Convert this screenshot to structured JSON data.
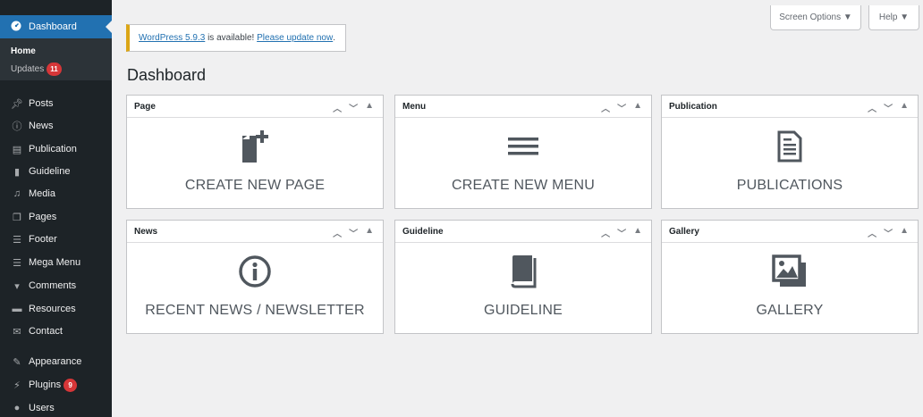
{
  "sidebar": {
    "dashboard_label": "Dashboard",
    "submenu": {
      "home": "Home",
      "updates": "Updates",
      "updates_badge": "11"
    },
    "items": [
      {
        "label": "Posts",
        "icon": "pin-icon"
      },
      {
        "label": "News",
        "icon": "info-icon"
      },
      {
        "label": "Publication",
        "icon": "document-icon"
      },
      {
        "label": "Guideline",
        "icon": "book-icon"
      },
      {
        "label": "Media",
        "icon": "media-icon"
      },
      {
        "label": "Pages",
        "icon": "pages-icon"
      },
      {
        "label": "Footer",
        "icon": "footer-icon"
      },
      {
        "label": "Mega Menu",
        "icon": "mega-menu-icon"
      },
      {
        "label": "Comments",
        "icon": "comment-icon"
      },
      {
        "label": "Resources",
        "icon": "folder-icon"
      },
      {
        "label": "Contact",
        "icon": "mail-icon"
      },
      {
        "label": "Appearance",
        "icon": "brush-icon"
      },
      {
        "label": "Plugins",
        "icon": "plug-icon",
        "badge": "9"
      },
      {
        "label": "Users",
        "icon": "user-icon"
      }
    ]
  },
  "header": {
    "screen_options": "Screen Options ▼",
    "help": "Help ▼"
  },
  "notice": {
    "version_link": "WordPress 5.9.3",
    "text": " is available! ",
    "update_link": "Please update now",
    "period": "."
  },
  "page_title": "Dashboard",
  "widgets": [
    {
      "title": "Page",
      "label": "CREATE NEW PAGE",
      "icon": "add-page-icon"
    },
    {
      "title": "Menu",
      "label": "CREATE NEW MENU",
      "icon": "menu-lines-icon"
    },
    {
      "title": "Publication",
      "label": "PUBLICATIONS",
      "icon": "document-icon"
    },
    {
      "title": "News",
      "label": "RECENT NEWS / NEWSLETTER",
      "icon": "info-icon"
    },
    {
      "title": "Guideline",
      "label": "GUIDELINE",
      "icon": "book-icon"
    },
    {
      "title": "Gallery",
      "label": "GALLERY",
      "icon": "gallery-icon"
    }
  ],
  "colors": {
    "sidebar_bg": "#1d2327",
    "active_blue": "#2271b1",
    "badge_red": "#d63638",
    "notice_border": "#dba617"
  }
}
